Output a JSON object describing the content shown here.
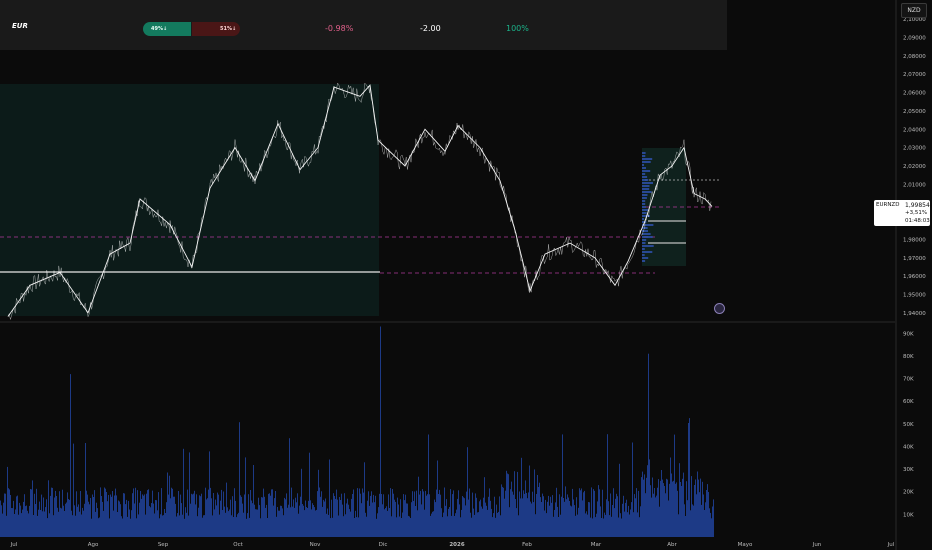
{
  "header": {
    "symbol": "EUR",
    "buy_pct": "49%↓",
    "sell_pct": "51%↓",
    "change": "-0.98%",
    "value": "-2.00",
    "percent": "100%"
  },
  "currency_button": "NZD",
  "price_tag": {
    "symbol": "EURNZD",
    "price": "1,99854",
    "change": "+3,51%",
    "time": "01:48:03"
  },
  "colors": {
    "background": "#0b0b0b",
    "candles": "#ffffff",
    "volume": "#1d3a86",
    "zone": "#0e2a26",
    "dashed_level": "#b03a9a",
    "header_bg": "#1a1a1a",
    "buy": "#137a5e",
    "sell": "#4a1616",
    "negative": "#e0608a",
    "positive": "#1bb38a"
  },
  "chart_data": [
    {
      "type": "line",
      "series": [
        {
          "x": [
            "Jul",
            "Ago",
            "Sep",
            "Oct",
            "Nov",
            "Dic",
            "2026",
            "Feb",
            "Mar",
            "Abr"
          ],
          "values": [
            1.946,
            1.953,
            1.985,
            2.012,
            2.054,
            2.018,
            2.026,
            1.975,
            1.961,
            2.026
          ]
        }
      ],
      "x_tick_labels": [
        "Jul",
        "Ago",
        "Sep",
        "Oct",
        "Nov",
        "Dic",
        "2026",
        "Feb",
        "Mar",
        "Abr",
        "Mayo",
        "Jun",
        "Jul"
      ],
      "y_tick_labels": [
        "2,10000",
        "2,09000",
        "2,08000",
        "2,07000",
        "2,06000",
        "2,05000",
        "2,04000",
        "2,03000",
        "2,02000",
        "2,01000",
        "2,00000",
        "1,99000",
        "1,98000",
        "1,97000",
        "1,96000",
        "1,95000",
        "1,94000"
      ],
      "ylim": [
        1.935,
        2.105
      ],
      "last_price": 1.99854
    },
    {
      "type": "bar",
      "y_tick_labels": [
        "90K",
        "80K",
        "70K",
        "60K",
        "50K",
        "40K",
        "30K",
        "20K",
        "10K"
      ],
      "ylim": [
        0,
        95000
      ],
      "peaks": [
        {
          "x": "Ago",
          "value": 72000
        },
        {
          "x": "Dic",
          "value": 93000
        },
        {
          "x": "Mar",
          "value": 81000
        }
      ]
    }
  ]
}
